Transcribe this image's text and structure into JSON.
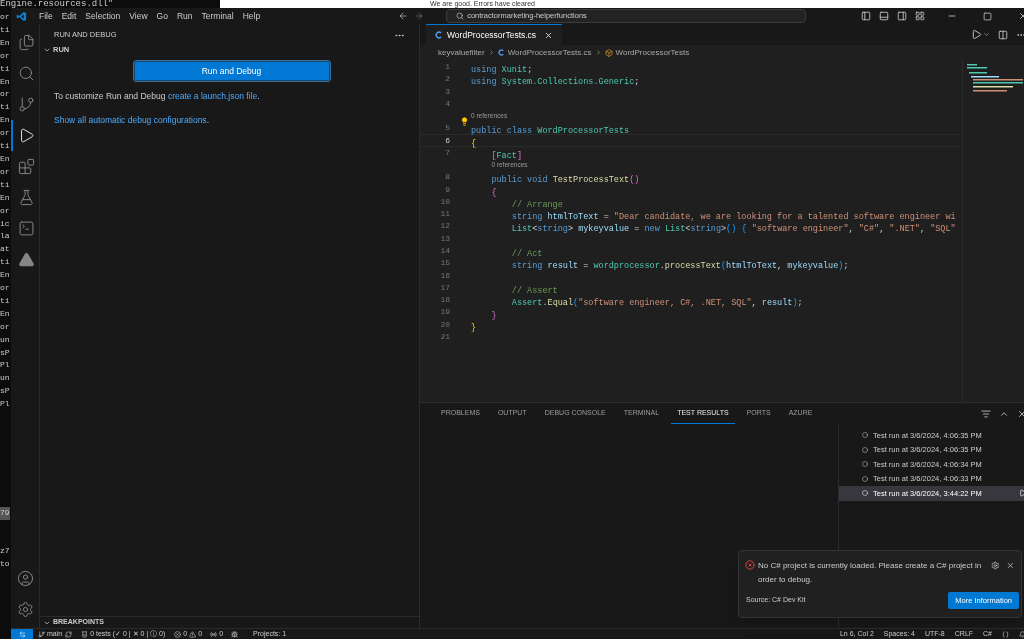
{
  "background": {
    "terminal_title": "Engine.resources.dll\"",
    "terminal_blocks": [
      [
        "or",
        "ti",
        "En",
        "or",
        "ti",
        "En",
        "or",
        "ti",
        "En",
        "or",
        "ti",
        "En",
        "or",
        "ti",
        "En",
        "or",
        "ic",
        "la",
        "at",
        "ti",
        "En",
        "or",
        "ti",
        "En",
        "or",
        "un",
        "sP",
        "Pl",
        "un",
        "sP",
        "Pl"
      ],
      [
        "79"
      ],
      [
        "z7",
        "to"
      ]
    ],
    "message": "We are good. Errors have cleared"
  },
  "menu": [
    "File",
    "Edit",
    "Selection",
    "View",
    "Go",
    "Run",
    "Terminal",
    "Help"
  ],
  "command_center": {
    "text": "contractormarketing-helperfunctions"
  },
  "activity_bar": [
    {
      "kind": "explorer",
      "selected": false
    },
    {
      "kind": "search",
      "selected": false
    },
    {
      "kind": "source-control",
      "selected": false
    },
    {
      "kind": "run-debug",
      "selected": true
    },
    {
      "kind": "extensions",
      "selected": false
    },
    {
      "kind": "testing",
      "selected": false
    },
    {
      "kind": "remote",
      "selected": false
    },
    {
      "kind": "azure",
      "selected": false
    }
  ],
  "sidebar": {
    "title": "RUN AND DEBUG",
    "section": "RUN",
    "button": "Run and Debug",
    "hint": "To customize Run and Debug ",
    "hint_link": "create a launch.json file",
    "hint_end": ".",
    "link": "Show all automatic debug configurations",
    "link_end": ".",
    "bottom_section": "BREAKPOINTS"
  },
  "editor": {
    "tab": {
      "label": "WordProcessorTests.cs",
      "selected": true
    },
    "breadcrumb": [
      "keyvaluefilter",
      "WordProcessorTests.cs",
      "WordProcessorTests"
    ],
    "lines": [
      {
        "number": "1",
        "current": false,
        "tokens": [
          {
            "text": "using ",
            "kind": "keyword"
          },
          {
            "text": "Xunit",
            "kind": "type"
          },
          {
            "text": ";",
            "kind": "plain"
          }
        ]
      },
      {
        "number": "2",
        "current": false,
        "tokens": [
          {
            "text": "using ",
            "kind": "keyword"
          },
          {
            "text": "System.Collections.Generic",
            "kind": "type"
          },
          {
            "text": ";",
            "kind": "plain"
          }
        ]
      },
      {
        "number": "3",
        "current": false
      },
      {
        "number": "4",
        "current": false
      },
      {
        "number": "5",
        "current": false,
        "codelens": "0 references",
        "lightbulb": true,
        "tokens": [
          {
            "text": "public class ",
            "kind": "keyword"
          },
          {
            "text": "WordProcessorTests",
            "kind": "type"
          }
        ]
      },
      {
        "number": "6",
        "current": true,
        "tokens": [
          {
            "text": "{",
            "kind": "bracket1"
          }
        ]
      },
      {
        "number": "7",
        "current": false,
        "tokens": [
          {
            "text": "    [",
            "kind": "bracket2"
          },
          {
            "text": "Fact",
            "kind": "type"
          },
          {
            "text": "]",
            "kind": "bracket2"
          }
        ]
      },
      {
        "number": "8",
        "current": false,
        "codelens": "0 references",
        "tokens": [
          {
            "text": "    public void ",
            "kind": "keyword"
          },
          {
            "text": "TestProcessText",
            "kind": "method"
          },
          {
            "text": "()",
            "kind": "bracket2"
          }
        ]
      },
      {
        "number": "9",
        "current": false,
        "tokens": [
          {
            "text": "    {",
            "kind": "bracket2"
          }
        ]
      },
      {
        "number": "10",
        "current": false,
        "tokens": [
          {
            "text": "        // Arrange",
            "kind": "comment"
          }
        ]
      },
      {
        "number": "11",
        "current": false,
        "tokens": [
          {
            "text": "        string ",
            "kind": "keyword"
          },
          {
            "text": "htmlToText",
            "kind": "variable"
          },
          {
            "text": " = ",
            "kind": "plain"
          },
          {
            "text": "\"Dear candidate, we are looking for a talented software engineer wi",
            "kind": "string"
          }
        ]
      },
      {
        "number": "12",
        "current": false,
        "tokens": [
          {
            "text": "        List",
            "kind": "type"
          },
          {
            "text": "<",
            "kind": "plain"
          },
          {
            "text": "string",
            "kind": "keyword"
          },
          {
            "text": "> ",
            "kind": "plain"
          },
          {
            "text": "mykeyvalue",
            "kind": "variable"
          },
          {
            "text": " = ",
            "kind": "plain"
          },
          {
            "text": "new ",
            "kind": "keyword"
          },
          {
            "text": "List",
            "kind": "type"
          },
          {
            "text": "<",
            "kind": "plain"
          },
          {
            "text": "string",
            "kind": "keyword"
          },
          {
            "text": ">",
            "kind": "plain"
          },
          {
            "text": "() { ",
            "kind": "bracket3"
          },
          {
            "text": "\"software engineer\"",
            "kind": "string"
          },
          {
            "text": ", ",
            "kind": "plain"
          },
          {
            "text": "\"C#\"",
            "kind": "string"
          },
          {
            "text": ", ",
            "kind": "plain"
          },
          {
            "text": "\".NET\"",
            "kind": "string"
          },
          {
            "text": ", ",
            "kind": "plain"
          },
          {
            "text": "\"SQL\"",
            "kind": "string"
          }
        ]
      },
      {
        "number": "13",
        "current": false
      },
      {
        "number": "14",
        "current": false,
        "tokens": [
          {
            "text": "        // Act",
            "kind": "comment"
          }
        ]
      },
      {
        "number": "15",
        "current": false,
        "tokens": [
          {
            "text": "        string ",
            "kind": "keyword"
          },
          {
            "text": "result",
            "kind": "variable"
          },
          {
            "text": " = ",
            "kind": "plain"
          },
          {
            "text": "wordprocessor",
            "kind": "type"
          },
          {
            "text": ".",
            "kind": "plain"
          },
          {
            "text": "processText",
            "kind": "method"
          },
          {
            "text": "(",
            "kind": "bracket3"
          },
          {
            "text": "htmlToText",
            "kind": "variable"
          },
          {
            "text": ", ",
            "kind": "plain"
          },
          {
            "text": "mykeyvalue",
            "kind": "variable"
          },
          {
            "text": ")",
            "kind": "bracket3"
          },
          {
            "text": ";",
            "kind": "plain"
          }
        ]
      },
      {
        "number": "16",
        "current": false
      },
      {
        "number": "17",
        "current": false,
        "tokens": [
          {
            "text": "        // Assert",
            "kind": "comment"
          }
        ]
      },
      {
        "number": "18",
        "current": false,
        "tokens": [
          {
            "text": "        Assert",
            "kind": "type"
          },
          {
            "text": ".",
            "kind": "plain"
          },
          {
            "text": "Equal",
            "kind": "method"
          },
          {
            "text": "(",
            "kind": "bracket3"
          },
          {
            "text": "\"software engineer, C#, .NET, SQL\"",
            "kind": "string"
          },
          {
            "text": ", ",
            "kind": "plain"
          },
          {
            "text": "result",
            "kind": "variable"
          },
          {
            "text": ")",
            "kind": "bracket3"
          },
          {
            "text": ";",
            "kind": "plain"
          }
        ]
      },
      {
        "number": "19",
        "current": false,
        "tokens": [
          {
            "text": "    }",
            "kind": "bracket2"
          }
        ]
      },
      {
        "number": "20",
        "current": false,
        "tokens": [
          {
            "text": "}",
            "kind": "bracket1"
          }
        ]
      },
      {
        "number": "21",
        "current": false
      }
    ]
  },
  "panel": {
    "tabs": [
      {
        "label": "PROBLEMS",
        "selected": false
      },
      {
        "label": "OUTPUT",
        "selected": false
      },
      {
        "label": "DEBUG CONSOLE",
        "selected": false
      },
      {
        "label": "TERMINAL",
        "selected": false
      },
      {
        "label": "TEST RESULTS",
        "selected": true
      },
      {
        "label": "PORTS",
        "selected": false
      },
      {
        "label": "AZURE",
        "selected": false
      }
    ],
    "test_runs": [
      {
        "label": "Test run at 3/6/2024, 4:06:35 PM",
        "selected": false
      },
      {
        "label": "Test run at 3/6/2024, 4:06:35 PM",
        "selected": false
      },
      {
        "label": "Test run at 3/6/2024, 4:06:34 PM",
        "selected": false
      },
      {
        "label": "Test run at 3/6/2024, 4:06:33 PM",
        "selected": false
      },
      {
        "label": "Test run at 3/6/2024, 3:44:22 PM",
        "selected": true
      }
    ]
  },
  "notification": {
    "message": "No C# project is currently loaded. Please create a C# project in order to debug.",
    "source": "Source: C# Dev Kit",
    "button": "More Information"
  },
  "status_bar": {
    "branch": "main",
    "tests": "0 tests (✓ 0 | ✕ 0 | ⓘ 0)",
    "errors": "0",
    "warnings": "0",
    "ports": "0",
    "projects": "Projects: 1",
    "right": [
      "Ln 6, Col 2",
      "Spaces: 4",
      "UTF-8",
      "CRLF",
      "C#"
    ]
  }
}
